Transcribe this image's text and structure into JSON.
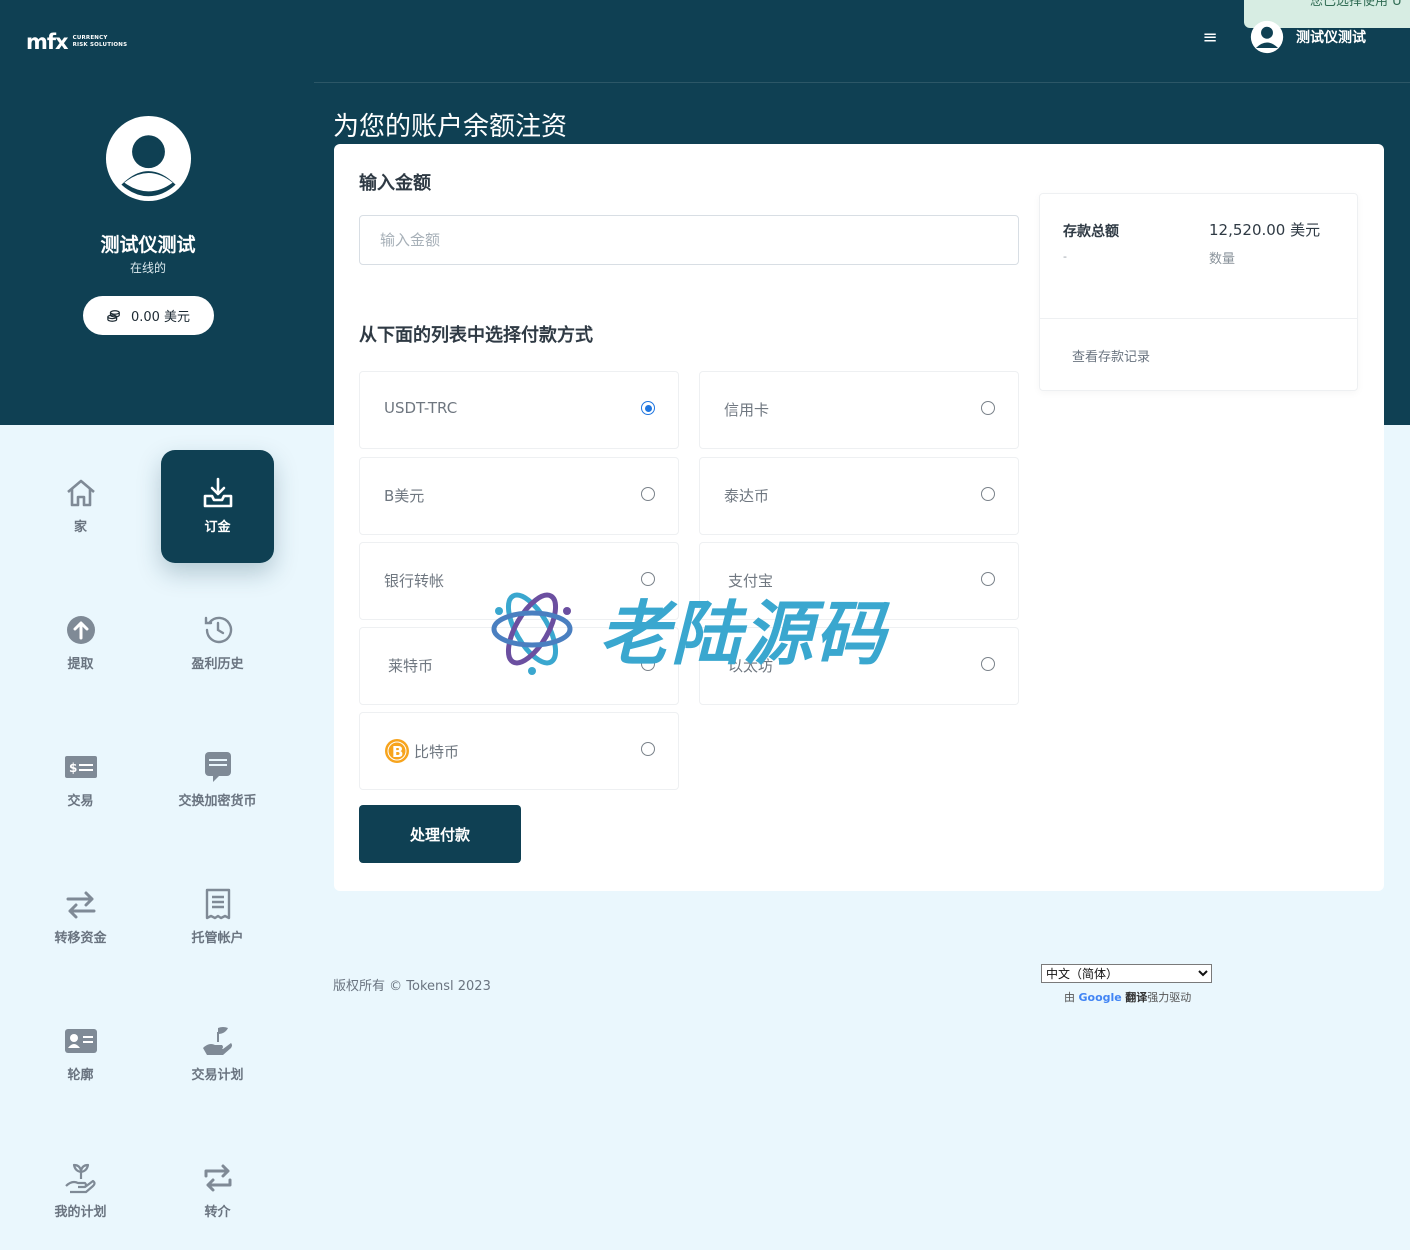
{
  "brand": {
    "logo_mark": "mfx",
    "logo_sub_1": "CURRENCY",
    "logo_sub_2": "RISK SOLUTIONS"
  },
  "header": {
    "menu_icon": "hamburger-icon",
    "username": "测试仪测试",
    "toast_text": "您已选择使用 U"
  },
  "profile": {
    "name": "测试仪测试",
    "status": "在线的",
    "balance": "0.00 美元"
  },
  "sidebar": {
    "items": [
      {
        "label": "家",
        "icon": "home-icon"
      },
      {
        "label": "订金",
        "icon": "deposit-icon",
        "active": true
      },
      {
        "label": "提取",
        "icon": "withdraw-icon"
      },
      {
        "label": "盈利历史",
        "icon": "history-icon"
      },
      {
        "label": "交易",
        "icon": "trade-icon"
      },
      {
        "label": "交换加密货币",
        "icon": "exchange-crypto-icon"
      },
      {
        "label": "转移资金",
        "icon": "transfer-icon"
      },
      {
        "label": "托管帐户",
        "icon": "receipt-icon"
      },
      {
        "label": "轮廓",
        "icon": "profile-card-icon"
      },
      {
        "label": "交易计划",
        "icon": "plan-hand-icon"
      },
      {
        "label": "我的计划",
        "icon": "plant-hand-icon"
      },
      {
        "label": "转介",
        "icon": "referral-icon"
      }
    ]
  },
  "page": {
    "title": "为您的账户余额注资"
  },
  "form": {
    "amount_title": "输入金额",
    "amount_placeholder": "输入金额",
    "amount_value": "",
    "method_title": "从下面的列表中选择付款方式",
    "methods": [
      {
        "label": "USDT-TRC",
        "selected": true
      },
      {
        "label": "信用卡",
        "selected": false
      },
      {
        "label": "B美元",
        "selected": false
      },
      {
        "label": "泰达币",
        "selected": false
      },
      {
        "label": "银行转帐",
        "selected": false
      },
      {
        "label": "支付宝",
        "selected": false
      },
      {
        "label": "莱特币",
        "selected": false
      },
      {
        "label": "以太坊",
        "selected": false
      },
      {
        "label": "比特币",
        "selected": false,
        "icon": "bitcoin-icon"
      }
    ],
    "submit_label": "处理付款"
  },
  "summary": {
    "title": "存款总额",
    "dash": "-",
    "amount": "12,520.00 美元",
    "amount_sub": "数量",
    "link": "查看存款记录"
  },
  "footer": {
    "copyright": "版权所有 © Tokensl 2023",
    "language": "中文（简体）",
    "powered_prefix": "由",
    "powered_google": "Google",
    "powered_translate": "翻译",
    "powered_suffix": "强力驱动"
  },
  "watermark": {
    "text": "老陆源码"
  },
  "colors": {
    "primary": "#0f4053",
    "background": "#eaf7fd",
    "radio_selected": "#1f76e0",
    "watermark": "#3aa7cf"
  }
}
